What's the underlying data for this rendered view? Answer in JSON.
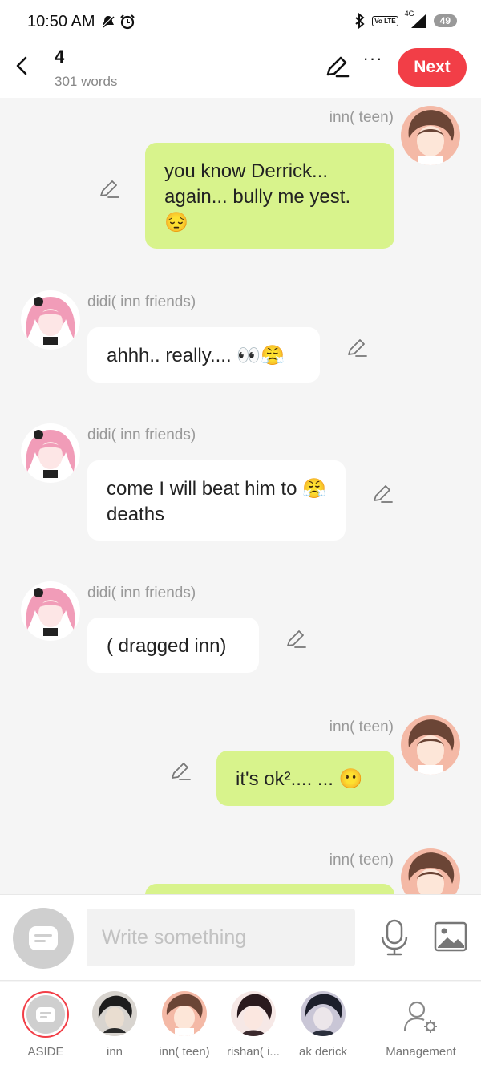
{
  "status_bar": {
    "time": "10:50 AM",
    "network": "4G",
    "volte": "Vo LTE",
    "battery": "49"
  },
  "header": {
    "chapter": "4",
    "word_count": "301 words",
    "next_label": "Next",
    "more_label": "···"
  },
  "colors": {
    "accent": "#f23e47",
    "bubble_right": "#d8f38c",
    "bubble_left": "#ffffff",
    "background": "#f5f5f5"
  },
  "messages": [
    {
      "sender": "inn( teen)",
      "side": "right",
      "text": "you know Derrick... again... bully me yest. 😔"
    },
    {
      "sender": "didi( inn friends)",
      "side": "left",
      "text": "ahhh.. really.... 👀😤"
    },
    {
      "sender": "didi( inn friends)",
      "side": "left",
      "text": "come I will beat him to 😤 deaths"
    },
    {
      "sender": "didi( inn friends)",
      "side": "left",
      "text": "( dragged inn)"
    },
    {
      "sender": "inn( teen)",
      "side": "right",
      "text": "it's ok².... ... 😶"
    },
    {
      "sender": "inn( teen)",
      "side": "right",
      "text": ""
    }
  ],
  "composer": {
    "placeholder": "Write something"
  },
  "characters": [
    {
      "name": "ASIDE"
    },
    {
      "name": "inn"
    },
    {
      "name": "inn( teen)"
    },
    {
      "name": "rishan( i..."
    },
    {
      "name": "ak derick"
    },
    {
      "name": "Management"
    }
  ]
}
